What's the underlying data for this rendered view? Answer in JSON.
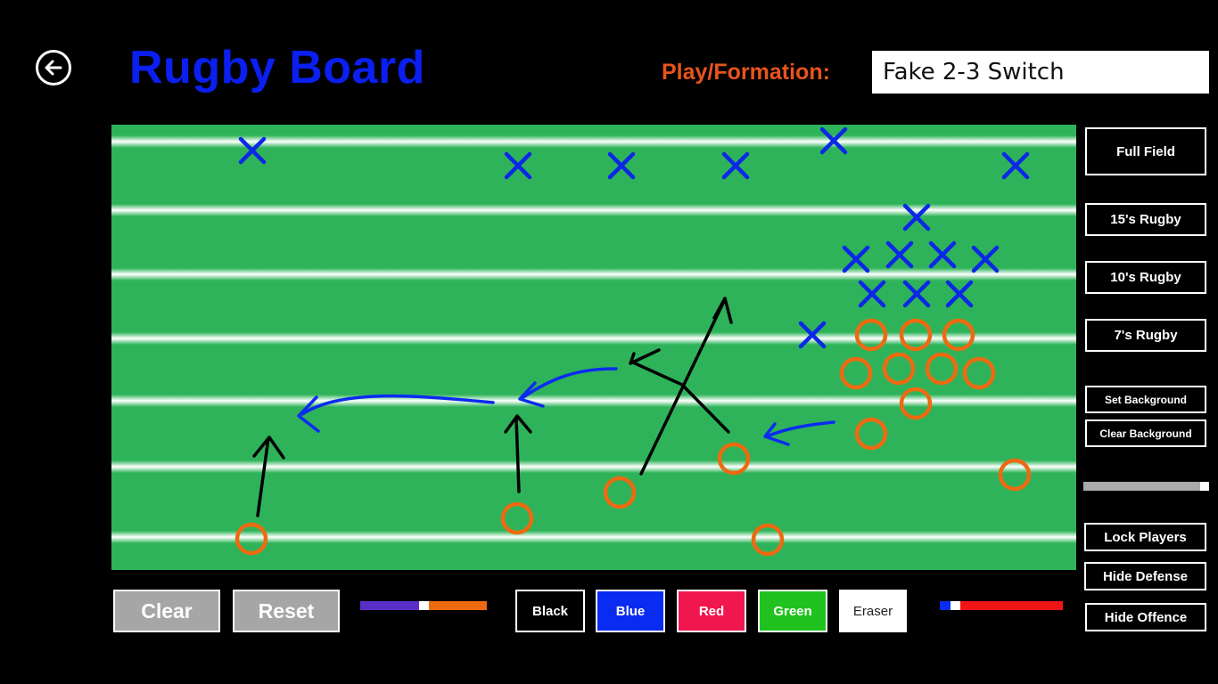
{
  "header": {
    "title": "Rugby Board",
    "play_label": "Play/Formation:",
    "play_value": "Fake 2-3 Switch"
  },
  "side_buttons": {
    "full_field": "Full Field",
    "rugby_15": "15's Rugby",
    "rugby_10": "10's Rugby",
    "rugby_7": "7's Rugby",
    "set_background": "Set Background",
    "clear_background": "Clear Background",
    "lock_players": "Lock Players",
    "hide_defense": "Hide Defense",
    "hide_offence": "Hide Offence"
  },
  "bottom_buttons": {
    "clear": "Clear",
    "reset": "Reset",
    "black": "Black",
    "blue": "Blue",
    "red": "Red",
    "green": "Green",
    "eraser": "Eraser"
  },
  "colors": {
    "title": "#0a1ff0",
    "label": "#e8541c",
    "field": "#2fb35a",
    "defense": "#0b28e6",
    "offence": "#ee6a10",
    "pen_black": "#000000",
    "pen_blue": "#0a2cf0",
    "pen_red": "#f0174e",
    "pen_green": "#1fc21f",
    "pen_eraser": "#ffffff"
  },
  "icons": {
    "back": "back-arrow-icon"
  }
}
